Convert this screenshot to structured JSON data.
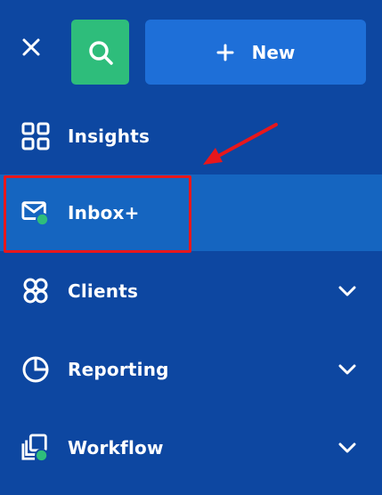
{
  "header": {
    "close_icon": "close-icon",
    "search_icon": "search-icon",
    "new_button_label": "New",
    "new_button_icon": "plus-icon"
  },
  "nav": {
    "items": [
      {
        "label": "Insights",
        "icon": "insights-grid-icon",
        "expandable": false,
        "active": false
      },
      {
        "label": "Inbox+",
        "icon": "inbox-mail-icon",
        "expandable": false,
        "active": true
      },
      {
        "label": "Clients",
        "icon": "clients-icon",
        "expandable": true,
        "active": false
      },
      {
        "label": "Reporting",
        "icon": "reporting-pie-icon",
        "expandable": true,
        "active": false
      },
      {
        "label": "Workflow",
        "icon": "workflow-icon",
        "expandable": true,
        "active": false
      }
    ]
  },
  "colors": {
    "background": "#0d47a1",
    "active_item": "#1565c0",
    "search_button": "#2ebd7b",
    "new_button": "#1e6fd8",
    "status_dot": "#2ebd7b",
    "annotation": "#e8171b"
  }
}
